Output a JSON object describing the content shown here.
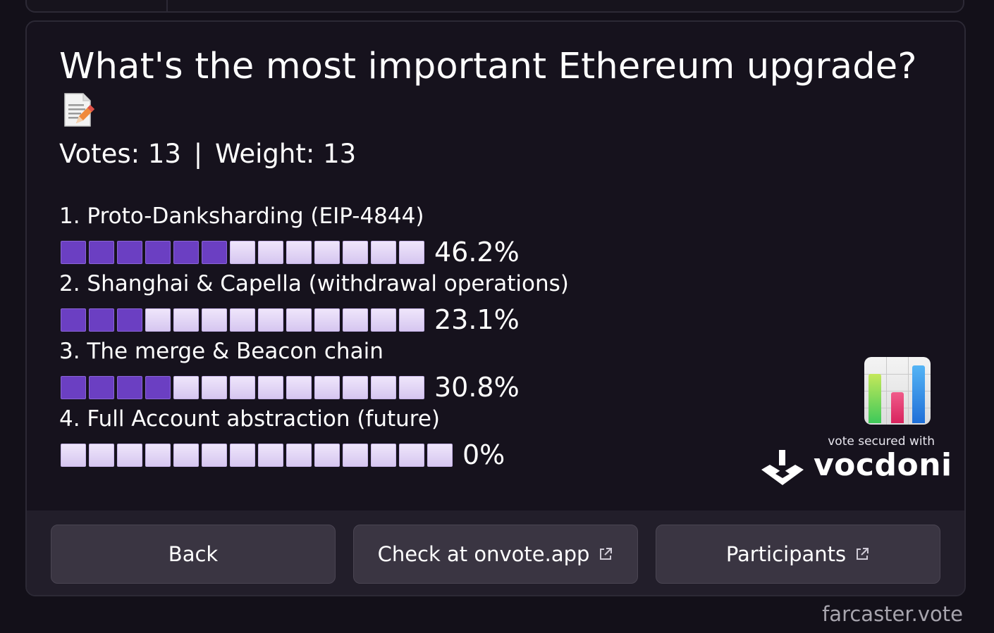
{
  "poll": {
    "question": "What's the most important Ethereum upgrade?",
    "question_icon": "memo-icon",
    "votes_label": "Votes: 13",
    "separator": "|",
    "weight_label": "Weight: 13",
    "options": [
      {
        "label": "1. Proto-Danksharding (EIP-4844)",
        "percent": "46.2%",
        "fraction": 0.462
      },
      {
        "label": "2. Shanghai & Capella (withdrawal operations)",
        "percent": "23.1%",
        "fraction": 0.231
      },
      {
        "label": "3. The merge & Beacon chain",
        "percent": "30.8%",
        "fraction": 0.308
      },
      {
        "label": "4. Full Account abstraction (future)",
        "percent": "0%",
        "fraction": 0.0
      }
    ]
  },
  "branding": {
    "secured_label": "vote secured with",
    "brand_name": "vocdoni",
    "chart_icon": "bar-chart-icon"
  },
  "actions": {
    "back_label": "Back",
    "check_label": "Check at onvote.app",
    "participants_label": "Participants",
    "link_icon": "external-link-icon"
  },
  "footer": {
    "domain": "farcaster.vote"
  },
  "colors": {
    "filled_segment": "#6b3fc2",
    "empty_segment": "#e4d8f6",
    "background": "#131019",
    "button": "#3a3542"
  }
}
